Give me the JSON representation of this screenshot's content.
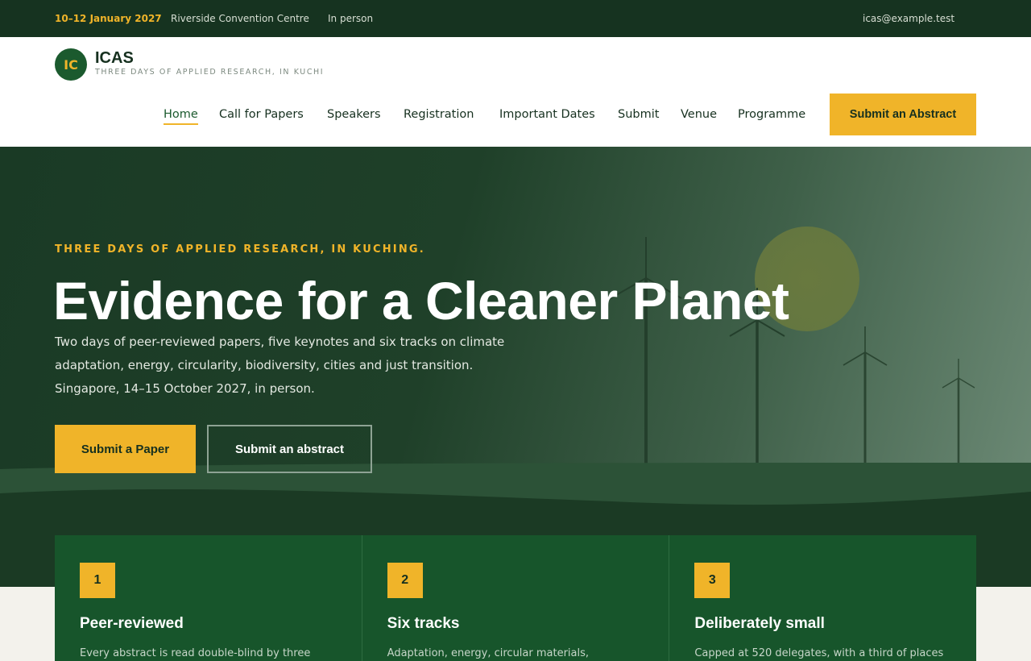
{
  "topbar": {
    "date": "10–12 January 2027",
    "venue": "Riverside Convention Centre",
    "format": "In person",
    "email": "icas@example.test"
  },
  "brand": {
    "initials": "IC",
    "name": "ICAS",
    "tagline": "THREE DAYS OF APPLIED RESEARCH, IN KUCHI"
  },
  "nav": {
    "items": [
      {
        "label": "Home"
      },
      {
        "label": "Call for Papers"
      },
      {
        "label": "Speakers"
      },
      {
        "label": "Registration"
      },
      {
        "label": "Important Dates"
      },
      {
        "label": "Submit"
      },
      {
        "label": "Venue"
      },
      {
        "label": "Programme"
      }
    ],
    "cta": "Submit an Abstract"
  },
  "hero": {
    "eyebrow": "THREE DAYS OF APPLIED RESEARCH, IN KUCHING.",
    "title": "Evidence for a Cleaner Planet",
    "text": [
      "Two days of peer-reviewed papers, five keynotes and six tracks on climate",
      "adaptation, energy, circularity, biodiversity, cities and just transition.",
      "Singapore, 14–15 October 2027, in person."
    ],
    "primary_button": "Submit a Paper",
    "secondary_button": "Submit an abstract"
  },
  "features": [
    {
      "number": "1",
      "title": "Peer-reviewed",
      "text": "Every abstract is read double-blind by three"
    },
    {
      "number": "2",
      "title": "Six tracks",
      "text": "Adaptation, energy, circular materials,"
    },
    {
      "number": "3",
      "title": "Deliberately small",
      "text": "Capped at 520 delegates, with a third of places"
    }
  ],
  "colors": {
    "accent": "#f0b429",
    "dark_green": "#163320",
    "brand_green": "#1b5a2e",
    "feature_green": "#17552b"
  }
}
